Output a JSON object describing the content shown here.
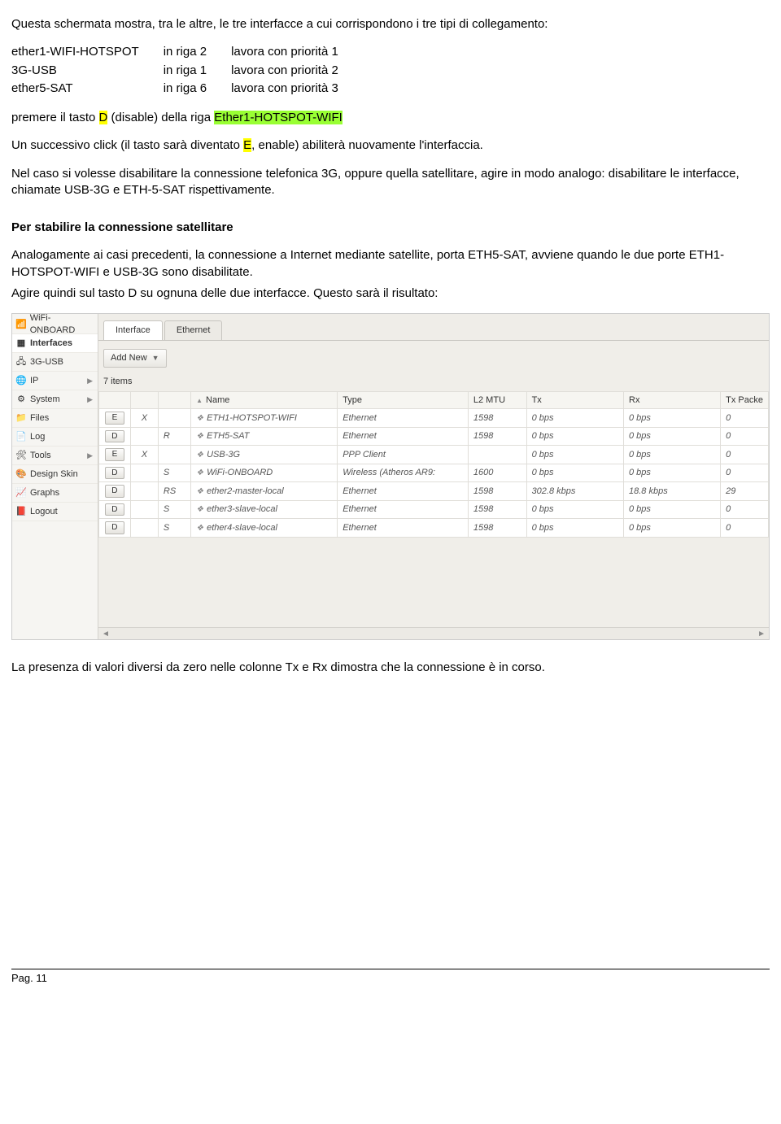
{
  "doc": {
    "intro": "Questa schermata mostra, tra le altre, le tre interfacce a cui corrispondono i tre tipi di collegamento:",
    "table": [
      {
        "if": "ether1-WIFI-HOTSPOT",
        "pos": "in riga 2",
        "pri": "lavora con priorità 1"
      },
      {
        "if": "3G-USB",
        "pos": "in riga 1",
        "pri": "lavora con priorità 2"
      },
      {
        "if": "ether5-SAT",
        "pos": "in riga 6",
        "pri": "lavora con priorità 3"
      }
    ],
    "p2a": "premere il tasto ",
    "p2b": "D",
    "p2c": " (disable) della riga ",
    "p2d": "Ether1-HOTSPOT-WIFI",
    "p3a": "Un successivo click (il tasto sarà diventato ",
    "p3b": "E",
    "p3c": ", enable) abiliterà nuovamente l'interfaccia.",
    "p4": "Nel caso si volesse disabilitare la connessione telefonica 3G, oppure quella satellitare, agire in modo analogo:  disabilitare le interfacce, chiamate USB-3G e ETH-5-SAT rispettivamente.",
    "h1": "Per stabilire la connessione satellitare",
    "p5": "Analogamente ai casi precedenti, la connessione a Internet mediante satellite, porta ETH5-SAT, avviene quando le due porte ETH1-HOTSPOT-WIFI e USB-3G sono disabilitate.",
    "p6": "Agire quindi sul tasto D su ognuna delle due interfacce. Questo sarà il risultato:",
    "p7": "La presenza di valori diversi da zero nelle colonne Tx e Rx dimostra che la connessione è in corso.",
    "footer": "Pag. 11"
  },
  "shot": {
    "sidebar": [
      {
        "label": "WiFi-ONBOARD",
        "icon": "📶"
      },
      {
        "label": "Interfaces",
        "icon": "▦",
        "active": true
      },
      {
        "label": "3G-USB",
        "icon": "🖧"
      },
      {
        "label": "IP",
        "icon": "🌐",
        "submenu": true
      },
      {
        "label": "System",
        "icon": "⚙",
        "submenu": true
      },
      {
        "label": "Files",
        "icon": "📁"
      },
      {
        "label": "Log",
        "icon": "📄"
      },
      {
        "label": "Tools",
        "icon": "🛠",
        "submenu": true
      },
      {
        "label": "Design Skin",
        "icon": "🎨"
      },
      {
        "label": "Graphs",
        "icon": "📈"
      },
      {
        "label": "Logout",
        "icon": "📕"
      }
    ],
    "tabs": {
      "t1": "Interface",
      "t2": "Ethernet"
    },
    "addnew": "Add New",
    "itemcount": "7 items",
    "headers": {
      "c0": "",
      "c1": "",
      "c2": "",
      "c3": "Name",
      "c4": "Type",
      "c5": "L2 MTU",
      "c6": "Tx",
      "c7": "Rx",
      "c8": "Tx Packe"
    },
    "rows": [
      {
        "btn": "E",
        "x": "X",
        "flag": "",
        "name": "ETH1-HOTSPOT-WIFI",
        "type": "Ethernet",
        "mtu": "1598",
        "tx": "0 bps",
        "rx": "0 bps",
        "txp": "0"
      },
      {
        "btn": "D",
        "x": "",
        "flag": "R",
        "name": "ETH5-SAT",
        "type": "Ethernet",
        "mtu": "1598",
        "tx": "0 bps",
        "rx": "0 bps",
        "txp": "0"
      },
      {
        "btn": "E",
        "x": "X",
        "flag": "",
        "name": "USB-3G",
        "type": "PPP Client",
        "mtu": "",
        "tx": "0 bps",
        "rx": "0 bps",
        "txp": "0"
      },
      {
        "btn": "D",
        "x": "",
        "flag": "S",
        "name": "WiFi-ONBOARD",
        "type": "Wireless (Atheros AR9:",
        "mtu": "1600",
        "tx": "0 bps",
        "rx": "0 bps",
        "txp": "0"
      },
      {
        "btn": "D",
        "x": "",
        "flag": "RS",
        "name": "ether2-master-local",
        "type": "Ethernet",
        "mtu": "1598",
        "tx": "302.8 kbps",
        "rx": "18.8 kbps",
        "txp": "29"
      },
      {
        "btn": "D",
        "x": "",
        "flag": "S",
        "name": "ether3-slave-local",
        "type": "Ethernet",
        "mtu": "1598",
        "tx": "0 bps",
        "rx": "0 bps",
        "txp": "0"
      },
      {
        "btn": "D",
        "x": "",
        "flag": "S",
        "name": "ether4-slave-local",
        "type": "Ethernet",
        "mtu": "1598",
        "tx": "0 bps",
        "rx": "0 bps",
        "txp": "0"
      }
    ]
  }
}
